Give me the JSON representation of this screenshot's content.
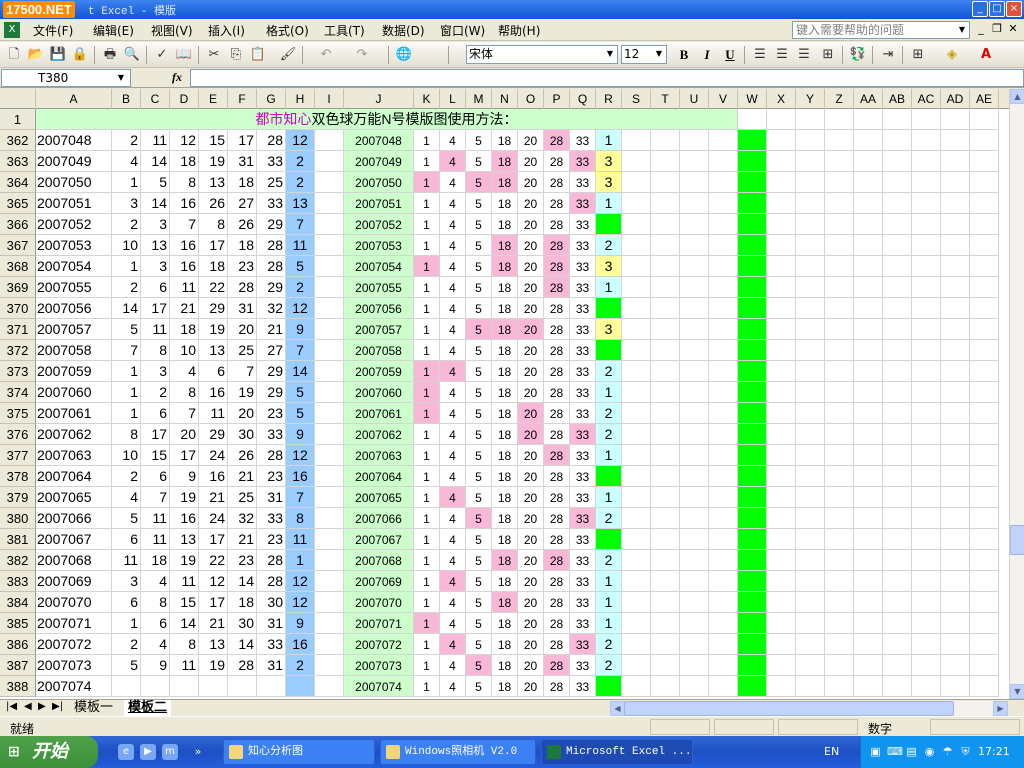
{
  "window": {
    "logo": "17500.NET",
    "title": "t Excel - 模版"
  },
  "menu": [
    "文件(F)",
    "编辑(E)",
    "视图(V)",
    "插入(I)",
    "格式(O)",
    "工具(T)",
    "数据(D)",
    "窗口(W)",
    "帮助(H)"
  ],
  "help_placeholder": "键入需要帮助的问题",
  "toolbar": {
    "font": "宋体",
    "size": "12",
    "bold": "B",
    "italic": "I",
    "underline": "U"
  },
  "namebox": "T380",
  "fx": "fx",
  "columns": [
    "A",
    "B",
    "C",
    "D",
    "E",
    "F",
    "G",
    "H",
    "I",
    "J",
    "K",
    "L",
    "M",
    "N",
    "O",
    "P",
    "Q",
    "R",
    "S",
    "T",
    "U",
    "V",
    "W",
    "X",
    "Y",
    "Z",
    "AA",
    "AB",
    "AC",
    "AD",
    "AE"
  ],
  "title_row": {
    "num": "1",
    "prefix": "都市知心",
    "rest": "双色球万能N号模版图使用方法："
  },
  "rows": [
    {
      "n": "362",
      "id": "2007048",
      "nums": [
        "2",
        "11",
        "12",
        "15",
        "17",
        "28"
      ],
      "h": "12",
      "r": "1",
      "rs": "c",
      "p": [
        0,
        0,
        0,
        0,
        0,
        1,
        0
      ]
    },
    {
      "n": "363",
      "id": "2007049",
      "nums": [
        "4",
        "14",
        "18",
        "19",
        "31",
        "33"
      ],
      "h": "2",
      "r": "3",
      "rs": "y",
      "p": [
        0,
        1,
        0,
        1,
        0,
        0,
        1
      ]
    },
    {
      "n": "364",
      "id": "2007050",
      "nums": [
        "1",
        "5",
        "8",
        "13",
        "18",
        "25"
      ],
      "h": "2",
      "r": "3",
      "rs": "y",
      "p": [
        1,
        0,
        1,
        1,
        0,
        0,
        0
      ]
    },
    {
      "n": "365",
      "id": "2007051",
      "nums": [
        "3",
        "14",
        "16",
        "26",
        "27",
        "33"
      ],
      "h": "13",
      "r": "1",
      "rs": "c",
      "p": [
        0,
        0,
        0,
        0,
        0,
        0,
        1
      ]
    },
    {
      "n": "366",
      "id": "2007052",
      "nums": [
        "2",
        "3",
        "7",
        "8",
        "26",
        "29"
      ],
      "h": "7",
      "r": "",
      "rs": "g",
      "p": [
        0,
        0,
        0,
        0,
        0,
        0,
        0
      ]
    },
    {
      "n": "367",
      "id": "2007053",
      "nums": [
        "10",
        "13",
        "16",
        "17",
        "18",
        "28"
      ],
      "h": "11",
      "r": "2",
      "rs": "c",
      "p": [
        0,
        0,
        0,
        1,
        0,
        1,
        0
      ]
    },
    {
      "n": "368",
      "id": "2007054",
      "nums": [
        "1",
        "3",
        "16",
        "18",
        "23",
        "28"
      ],
      "h": "5",
      "r": "3",
      "rs": "y",
      "p": [
        1,
        0,
        0,
        1,
        0,
        1,
        0
      ]
    },
    {
      "n": "369",
      "id": "2007055",
      "nums": [
        "2",
        "6",
        "11",
        "22",
        "28",
        "29"
      ],
      "h": "2",
      "r": "1",
      "rs": "c",
      "p": [
        0,
        0,
        0,
        0,
        0,
        1,
        0
      ]
    },
    {
      "n": "370",
      "id": "2007056",
      "nums": [
        "14",
        "17",
        "21",
        "29",
        "31",
        "32"
      ],
      "h": "12",
      "r": "",
      "rs": "g",
      "p": [
        0,
        0,
        0,
        0,
        0,
        0,
        0
      ]
    },
    {
      "n": "371",
      "id": "2007057",
      "nums": [
        "5",
        "11",
        "18",
        "19",
        "20",
        "21"
      ],
      "h": "9",
      "r": "3",
      "rs": "y",
      "p": [
        0,
        0,
        1,
        1,
        1,
        0,
        0
      ]
    },
    {
      "n": "372",
      "id": "2007058",
      "nums": [
        "7",
        "8",
        "10",
        "13",
        "25",
        "27"
      ],
      "h": "7",
      "r": "",
      "rs": "g",
      "p": [
        0,
        0,
        0,
        0,
        0,
        0,
        0
      ]
    },
    {
      "n": "373",
      "id": "2007059",
      "nums": [
        "1",
        "3",
        "4",
        "6",
        "7",
        "29"
      ],
      "h": "14",
      "r": "2",
      "rs": "c",
      "p": [
        1,
        1,
        0,
        0,
        0,
        0,
        0
      ]
    },
    {
      "n": "374",
      "id": "2007060",
      "nums": [
        "1",
        "2",
        "8",
        "16",
        "19",
        "29"
      ],
      "h": "5",
      "r": "1",
      "rs": "c",
      "p": [
        1,
        0,
        0,
        0,
        0,
        0,
        0
      ]
    },
    {
      "n": "375",
      "id": "2007061",
      "nums": [
        "1",
        "6",
        "7",
        "11",
        "20",
        "23"
      ],
      "h": "5",
      "r": "2",
      "rs": "c",
      "p": [
        1,
        0,
        0,
        0,
        1,
        0,
        0
      ]
    },
    {
      "n": "376",
      "id": "2007062",
      "nums": [
        "8",
        "17",
        "20",
        "29",
        "30",
        "33"
      ],
      "h": "9",
      "r": "2",
      "rs": "c",
      "p": [
        0,
        0,
        0,
        0,
        1,
        0,
        1
      ]
    },
    {
      "n": "377",
      "id": "2007063",
      "nums": [
        "10",
        "15",
        "17",
        "24",
        "26",
        "28"
      ],
      "h": "12",
      "r": "1",
      "rs": "c",
      "p": [
        0,
        0,
        0,
        0,
        0,
        1,
        0
      ]
    },
    {
      "n": "378",
      "id": "2007064",
      "nums": [
        "2",
        "6",
        "9",
        "16",
        "21",
        "23"
      ],
      "h": "16",
      "r": "",
      "rs": "g",
      "p": [
        0,
        0,
        0,
        0,
        0,
        0,
        0
      ]
    },
    {
      "n": "379",
      "id": "2007065",
      "nums": [
        "4",
        "7",
        "19",
        "21",
        "25",
        "31"
      ],
      "h": "7",
      "r": "1",
      "rs": "c",
      "p": [
        0,
        1,
        0,
        0,
        0,
        0,
        0
      ]
    },
    {
      "n": "380",
      "id": "2007066",
      "nums": [
        "5",
        "11",
        "16",
        "24",
        "32",
        "33"
      ],
      "h": "8",
      "r": "2",
      "rs": "c",
      "p": [
        0,
        0,
        1,
        0,
        0,
        0,
        1
      ]
    },
    {
      "n": "381",
      "id": "2007067",
      "nums": [
        "6",
        "11",
        "13",
        "17",
        "21",
        "23"
      ],
      "h": "11",
      "r": "",
      "rs": "g",
      "p": [
        0,
        0,
        0,
        0,
        0,
        0,
        0
      ]
    },
    {
      "n": "382",
      "id": "2007068",
      "nums": [
        "11",
        "18",
        "19",
        "22",
        "23",
        "28"
      ],
      "h": "1",
      "r": "2",
      "rs": "c",
      "p": [
        0,
        0,
        0,
        1,
        0,
        1,
        0
      ]
    },
    {
      "n": "383",
      "id": "2007069",
      "nums": [
        "3",
        "4",
        "11",
        "12",
        "14",
        "28"
      ],
      "h": "12",
      "r": "1",
      "rs": "c",
      "p": [
        0,
        1,
        0,
        0,
        0,
        0,
        0
      ]
    },
    {
      "n": "384",
      "id": "2007070",
      "nums": [
        "6",
        "8",
        "15",
        "17",
        "18",
        "30"
      ],
      "h": "12",
      "r": "1",
      "rs": "c",
      "p": [
        0,
        0,
        0,
        1,
        0,
        0,
        0
      ]
    },
    {
      "n": "385",
      "id": "2007071",
      "nums": [
        "1",
        "6",
        "14",
        "21",
        "30",
        "31"
      ],
      "h": "9",
      "r": "1",
      "rs": "c",
      "p": [
        1,
        0,
        0,
        0,
        0,
        0,
        0
      ]
    },
    {
      "n": "386",
      "id": "2007072",
      "nums": [
        "2",
        "4",
        "8",
        "13",
        "14",
        "33"
      ],
      "h": "16",
      "r": "2",
      "rs": "c",
      "p": [
        0,
        1,
        0,
        0,
        0,
        0,
        1
      ]
    },
    {
      "n": "387",
      "id": "2007073",
      "nums": [
        "5",
        "9",
        "11",
        "19",
        "28",
        "31"
      ],
      "h": "2",
      "r": "2",
      "rs": "c",
      "p": [
        0,
        0,
        1,
        0,
        0,
        1,
        0
      ]
    },
    {
      "n": "388",
      "id": "2007074",
      "nums": [
        "",
        "",
        "",
        "",
        "",
        "",
        ""
      ],
      "h": "",
      "r": "",
      "rs": "g",
      "p": [
        0,
        0,
        0,
        0,
        0,
        0,
        0
      ]
    }
  ],
  "ref_values": [
    "1",
    "4",
    "5",
    "18",
    "20",
    "28",
    "33"
  ],
  "sheets": [
    "模板一",
    "模板二"
  ],
  "status": {
    "ready": "就绪",
    "num": "数字"
  },
  "taskbar": {
    "start": "开始",
    "tasks": [
      "知心分析图",
      "Windows照相机 V2.0",
      "Microsoft Excel ..."
    ],
    "lang": "EN",
    "clock": "17:21"
  }
}
